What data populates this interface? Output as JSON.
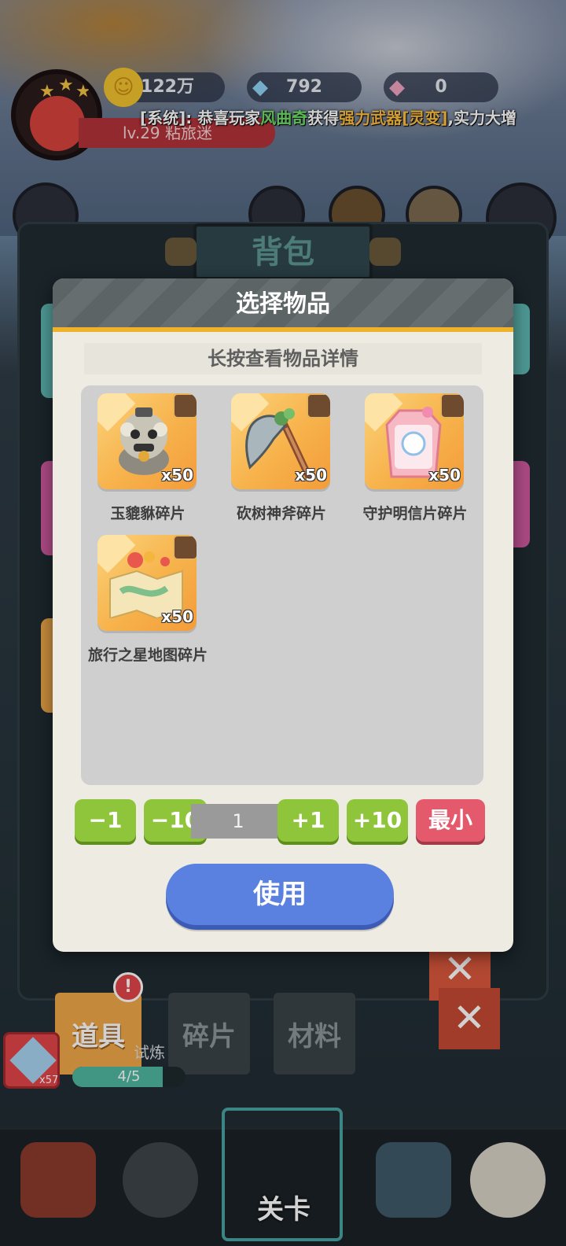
{
  "hud": {
    "level": "lv.29 粘旅迷",
    "gold": "122万",
    "diamonds": "792",
    "crystals": "0",
    "system_message": {
      "prefix": "[系统]: 恭喜玩家",
      "player": "风曲奇",
      "verb": "获得",
      "item": "强力武器[灵变]",
      "suffix": ",实力大增"
    }
  },
  "bag": {
    "title": "背包",
    "tabs": {
      "items": "道具",
      "shards": "碎片",
      "materials": "材料"
    },
    "alert": "!",
    "progress_text": "4/5",
    "progress_fraction": 0.8,
    "ore_count": "x57",
    "trial_label": "试炼"
  },
  "modal": {
    "title": "选择物品",
    "subtitle": "长按查看物品详情",
    "items": [
      {
        "name": "玉貔貅碎片",
        "qty": "x50",
        "icon": "pixiu-statue-icon"
      },
      {
        "name": "砍树神斧碎片",
        "qty": "x50",
        "icon": "axe-icon"
      },
      {
        "name": "守护明信片碎片",
        "qty": "x50",
        "icon": "postcard-icon"
      },
      {
        "name": "旅行之星地图碎片",
        "qty": "x50",
        "icon": "map-icon"
      }
    ],
    "controls": {
      "minus1": "−1",
      "minus10": "−10",
      "value": "1",
      "plus1": "+1",
      "plus10": "+10",
      "min": "最小"
    },
    "use_label": "使用"
  },
  "nav": {
    "stage_label": "关卡"
  },
  "colors": {
    "accent_yellow": "#f0b22b",
    "button_green": "#8fc53a",
    "button_pink": "#e45a6c",
    "button_blue": "#5a80e0",
    "item_card": "#f7b24b"
  }
}
